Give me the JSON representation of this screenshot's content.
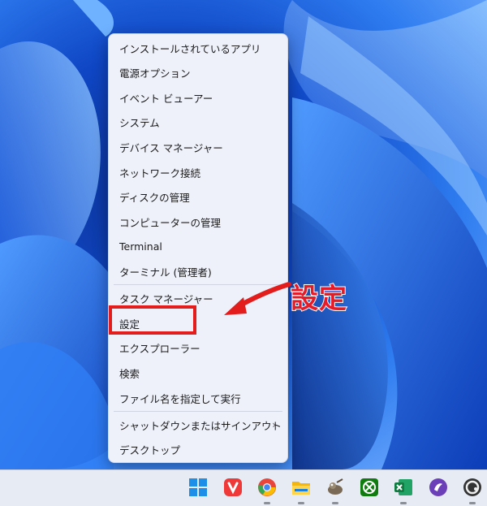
{
  "menu": {
    "items": [
      {
        "label": "インストールされているアプリ"
      },
      {
        "label": "電源オプション"
      },
      {
        "label": "イベント ビューアー"
      },
      {
        "label": "システム"
      },
      {
        "label": "デバイス マネージャー"
      },
      {
        "label": "ネットワーク接続"
      },
      {
        "label": "ディスクの管理"
      },
      {
        "label": "コンピューターの管理"
      },
      {
        "label": "Terminal"
      },
      {
        "label": "ターミナル (管理者)"
      },
      {
        "label": "タスク マネージャー"
      },
      {
        "label": "設定"
      },
      {
        "label": "エクスプローラー"
      },
      {
        "label": "検索"
      },
      {
        "label": "ファイル名を指定して実行"
      },
      {
        "label": "シャットダウンまたはサインアウト",
        "submenu_chevron": "›"
      },
      {
        "label": "デスクトップ"
      }
    ]
  },
  "annotation": {
    "text": "設定",
    "highlight_color": "#e31c1c"
  },
  "taskbar": {
    "icons": [
      "windows-start-icon",
      "vivaldi-icon",
      "chrome-icon",
      "file-explorer-icon",
      "gimp-icon",
      "xbox-icon",
      "excel-icon",
      "app-purple-icon",
      "app-circle-icon"
    ]
  }
}
